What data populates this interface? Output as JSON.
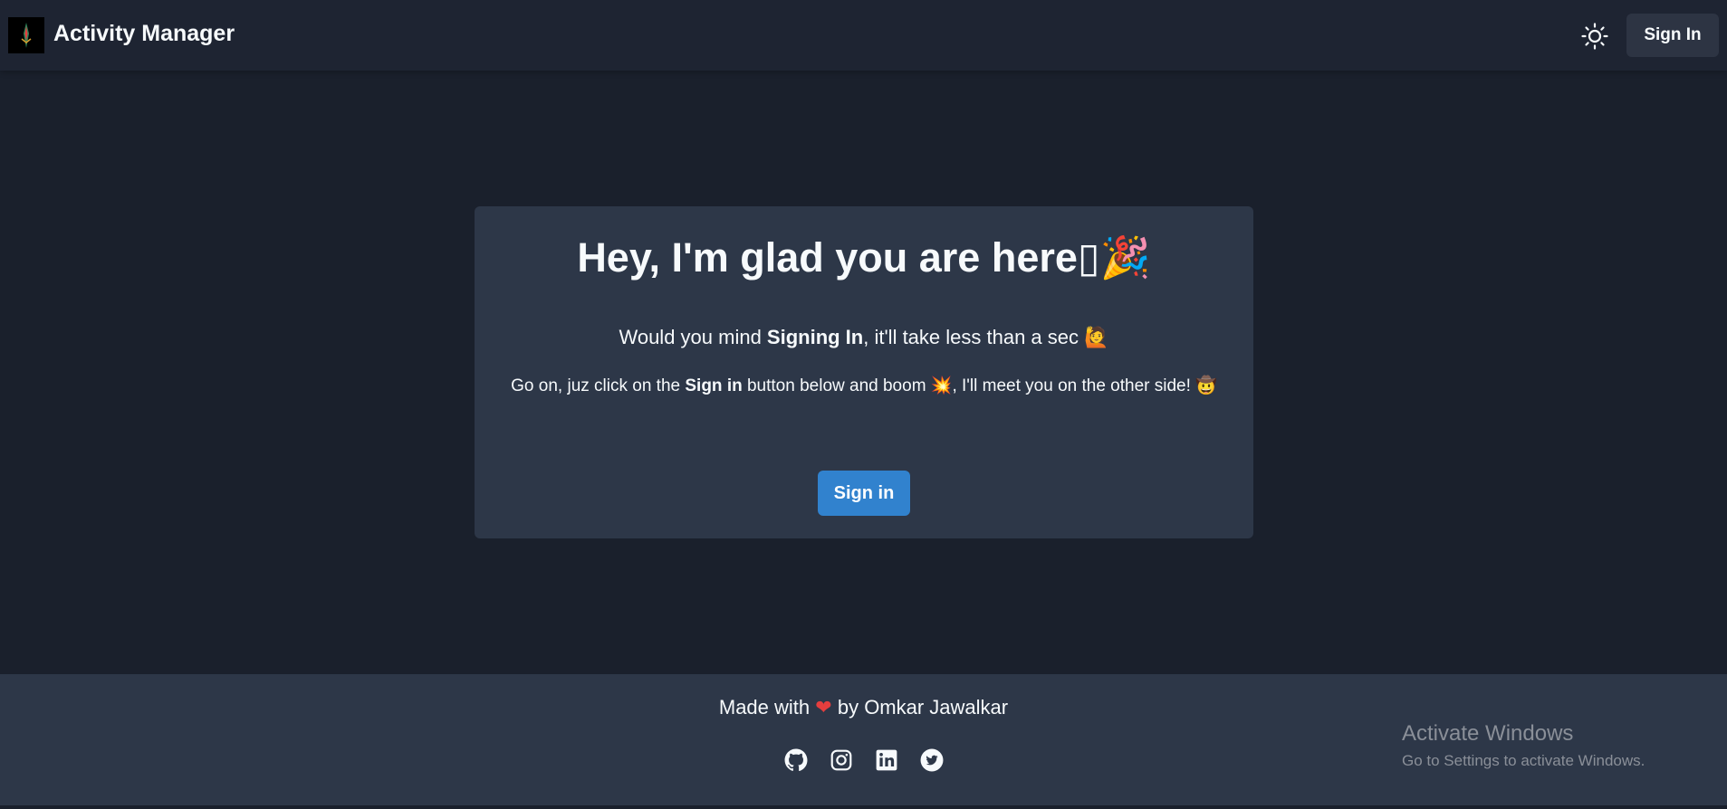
{
  "navbar": {
    "brand": "Activity Manager",
    "logo_icon": "rocket-logo-icon",
    "theme_icon": "sun-icon",
    "signin_label": "Sign In"
  },
  "card": {
    "title": "Hey, I'm glad you are here▯🎉",
    "line1_pre": "Would you mind ",
    "line1_bold": "Signing In",
    "line1_post": ", it'll take less than a sec 🙋",
    "line2_pre": "Go on, juz click on the ",
    "line2_bold": "Sign in",
    "line2_post": " button below and boom 💥, I'll meet you on the other side! 🤠",
    "button_label": "Sign in"
  },
  "footer": {
    "made_with": "Made with",
    "heart": "❤",
    "by": "by Omkar Jawalkar",
    "socials": [
      "github-icon",
      "instagram-icon",
      "linkedin-icon",
      "twitter-icon"
    ]
  },
  "watermark": {
    "title": "Activate Windows",
    "subtitle": "Go to Settings to activate Windows."
  },
  "colors": {
    "background": "#1a202c",
    "navbar": "#1e2432",
    "card": "#2d3748",
    "primary_button": "#3182ce",
    "heart": "#e53e3e"
  }
}
